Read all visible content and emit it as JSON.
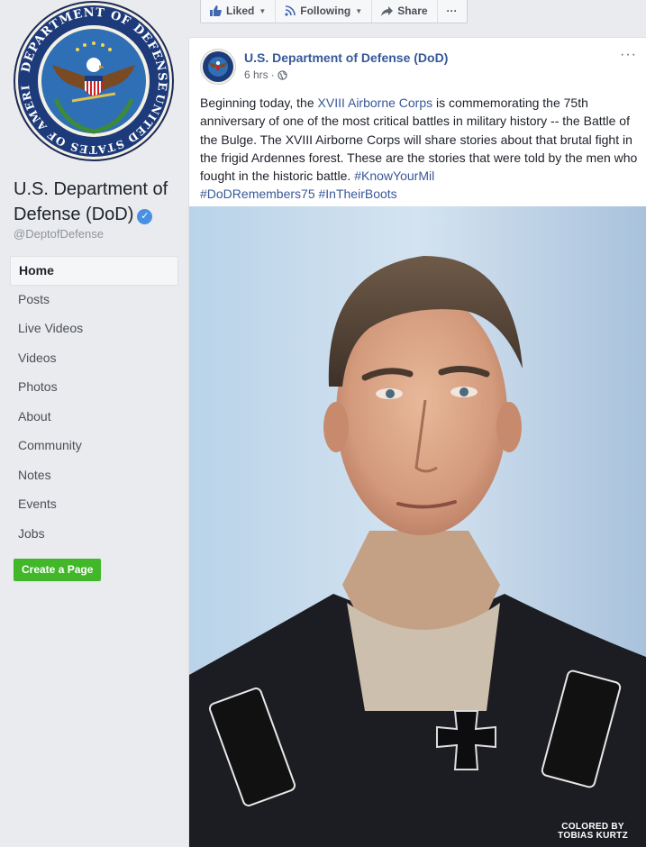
{
  "sidebar": {
    "page_name": "U.S. Department of Defense (DoD)",
    "handle": "@DeptofDefense",
    "seal_text": "DEPARTMENT OF DEFENSE · UNITED STATES OF AMERICA",
    "nav": [
      {
        "label": "Home",
        "active": true
      },
      {
        "label": "Posts"
      },
      {
        "label": "Live Videos"
      },
      {
        "label": "Videos"
      },
      {
        "label": "Photos"
      },
      {
        "label": "About"
      },
      {
        "label": "Community"
      },
      {
        "label": "Notes"
      },
      {
        "label": "Events"
      },
      {
        "label": "Jobs"
      }
    ],
    "create_page_label": "Create a Page"
  },
  "actions": {
    "liked_label": "Liked",
    "following_label": "Following",
    "share_label": "Share",
    "more_label": "···"
  },
  "post": {
    "author": "U.S. Department of Defense (DoD)",
    "time": "6 hrs",
    "privacy_icon": "globe-icon",
    "text_1": "Beginning today, the ",
    "link_1": "XVIII Airborne Corps",
    "text_2": " is commemorating the 75th anniversary of one of the most critical battles in military history -- the Battle of the Bulge. The XVIII Airborne Corps will share stories about that brutal fight in the frigid Ardennes forest. These are the stories that were told by the men who fought in the historic battle. ",
    "hashtag_1": "#KnowYourMil",
    "hashtag_2": "#DoDRemembers75",
    "hashtag_3": "#InTheirBoots",
    "photo_credit_1": "COLORED BY",
    "photo_credit_2": "TOBIAS KURTZ",
    "more_label": "···"
  },
  "colors": {
    "link": "#385898",
    "author": "#365899",
    "create_button": "#42b72a",
    "verified": "#4a90e2"
  }
}
